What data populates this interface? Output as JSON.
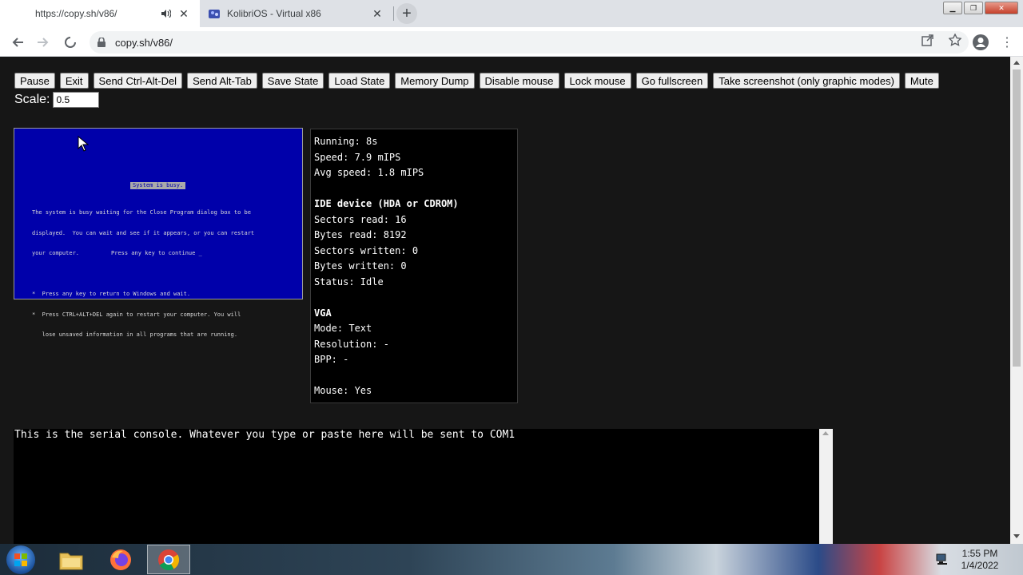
{
  "browser": {
    "tabs": [
      {
        "title": "https://copy.sh/v86/",
        "active": true
      },
      {
        "title": "KolibriOS - Virtual x86",
        "active": false
      }
    ],
    "url": "copy.sh/v86/"
  },
  "controls": {
    "buttons": [
      "Pause",
      "Exit",
      "Send Ctrl-Alt-Del",
      "Send Alt-Tab",
      "Save State",
      "Load State",
      "Memory Dump",
      "Disable mouse",
      "Lock mouse",
      "Go fullscreen",
      "Take screenshot (only graphic modes)",
      "Mute"
    ],
    "scale_label": "Scale:",
    "scale_value": "0.5"
  },
  "vm_screen": {
    "banner": "System is busy.",
    "lines": [
      "The system is busy waiting for the Close Program dialog box to be",
      "displayed.  You can wait and see if it appears, or you can restart",
      "your computer.",
      "",
      "*  Press any key to return to Windows and wait.",
      "*  Press CTRL+ALT+DEL again to restart your computer. You will",
      "   lose unsaved information in all programs that are running."
    ],
    "continue_text": "Press any key to continue _"
  },
  "stats": {
    "running": "Running: 8s",
    "speed": "Speed: 7.9 mIPS",
    "avg_speed": "Avg speed: 1.8 mIPS",
    "ide_header": "IDE device (HDA or CDROM)",
    "sectors_read": "Sectors read: 16",
    "bytes_read": "Bytes read: 8192",
    "sectors_written": "Sectors written: 0",
    "bytes_written": "Bytes written: 0",
    "status": "Status: Idle",
    "vga_header": "VGA",
    "mode": "Mode: Text",
    "resolution": "Resolution: -",
    "bpp": "BPP: -",
    "mouse": "Mouse: Yes"
  },
  "serial": {
    "text": "This is the serial console. Whatever you type or paste here will be sent to COM1"
  },
  "taskbar": {
    "time": "1:55 PM",
    "date": "1/4/2022"
  }
}
